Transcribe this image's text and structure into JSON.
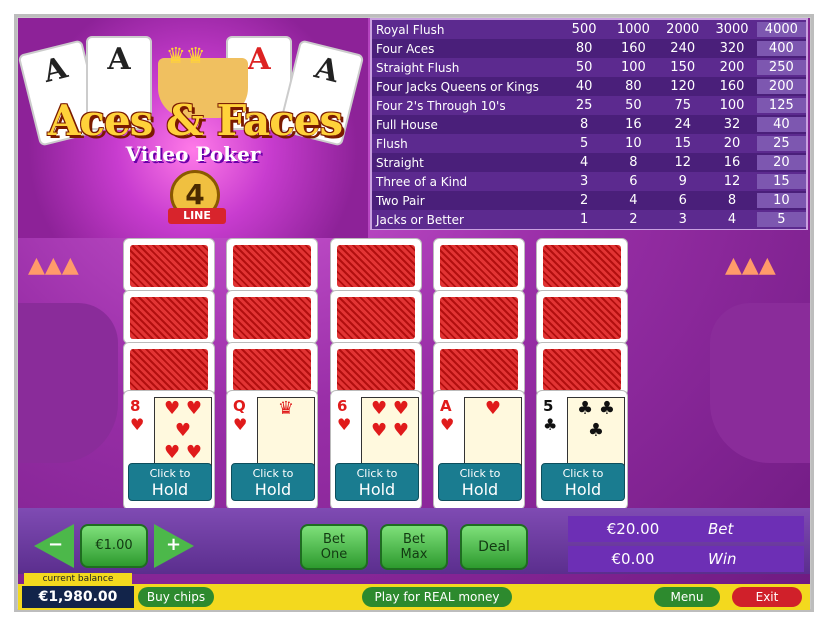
{
  "logo": {
    "title": "Aces & Faces",
    "subtitle": "Video Poker",
    "lines_number": "4",
    "lines_label": "LINE",
    "bg_card_rank": "A"
  },
  "paytable": {
    "rows": [
      {
        "hand": "Royal Flush",
        "payouts": [
          "500",
          "1000",
          "2000",
          "3000",
          "4000"
        ]
      },
      {
        "hand": "Four Aces",
        "payouts": [
          "80",
          "160",
          "240",
          "320",
          "400"
        ]
      },
      {
        "hand": "Straight Flush",
        "payouts": [
          "50",
          "100",
          "150",
          "200",
          "250"
        ]
      },
      {
        "hand": "Four Jacks Queens or Kings",
        "payouts": [
          "40",
          "80",
          "120",
          "160",
          "200"
        ]
      },
      {
        "hand": "Four 2's Through 10's",
        "payouts": [
          "25",
          "50",
          "75",
          "100",
          "125"
        ]
      },
      {
        "hand": "Full House",
        "payouts": [
          "8",
          "16",
          "24",
          "32",
          "40"
        ]
      },
      {
        "hand": "Flush",
        "payouts": [
          "5",
          "10",
          "15",
          "20",
          "25"
        ]
      },
      {
        "hand": "Straight",
        "payouts": [
          "4",
          "8",
          "12",
          "16",
          "20"
        ]
      },
      {
        "hand": "Three of a Kind",
        "payouts": [
          "3",
          "6",
          "9",
          "12",
          "15"
        ]
      },
      {
        "hand": "Two Pair",
        "payouts": [
          "2",
          "4",
          "6",
          "8",
          "10"
        ]
      },
      {
        "hand": "Jacks or Better",
        "payouts": [
          "1",
          "2",
          "3",
          "4",
          "5"
        ]
      }
    ]
  },
  "cards": [
    {
      "rank": "8",
      "suit": "♥",
      "color": "red",
      "pic": "♥ ♥\n♥\n♥ ♥"
    },
    {
      "rank": "Q",
      "suit": "♥",
      "color": "red",
      "pic": "♛"
    },
    {
      "rank": "6",
      "suit": "♥",
      "color": "red",
      "pic": "♥ ♥\n♥ ♥"
    },
    {
      "rank": "A",
      "suit": "♥",
      "color": "red",
      "pic": "♥"
    },
    {
      "rank": "5",
      "suit": "♣",
      "color": "black",
      "pic": "♣ ♣\n♣"
    }
  ],
  "hold_button": {
    "line1": "Click to",
    "line2": "Hold"
  },
  "controls": {
    "coin_value": "€1.00",
    "minus_icon": "minus-icon",
    "plus_icon": "plus-icon",
    "bet_one_line1": "Bet",
    "bet_one_line2": "One",
    "bet_max_line1": "Bet",
    "bet_max_line2": "Max",
    "deal": "Deal",
    "bet_value": "€20.00",
    "bet_label": "Bet",
    "win_value": "€0.00",
    "win_label": "Win"
  },
  "status": {
    "balance_label": "current balance",
    "balance_value": "€1,980.00",
    "buy_chips": "Buy chips",
    "play_real": "Play for REAL money",
    "menu": "Menu",
    "exit": "Exit"
  },
  "colors": {
    "accent_green": "#2d9a2e",
    "panel_purple": "#6d2fb5",
    "status_yellow": "#f3d91e",
    "exit_red": "#d0202a"
  }
}
